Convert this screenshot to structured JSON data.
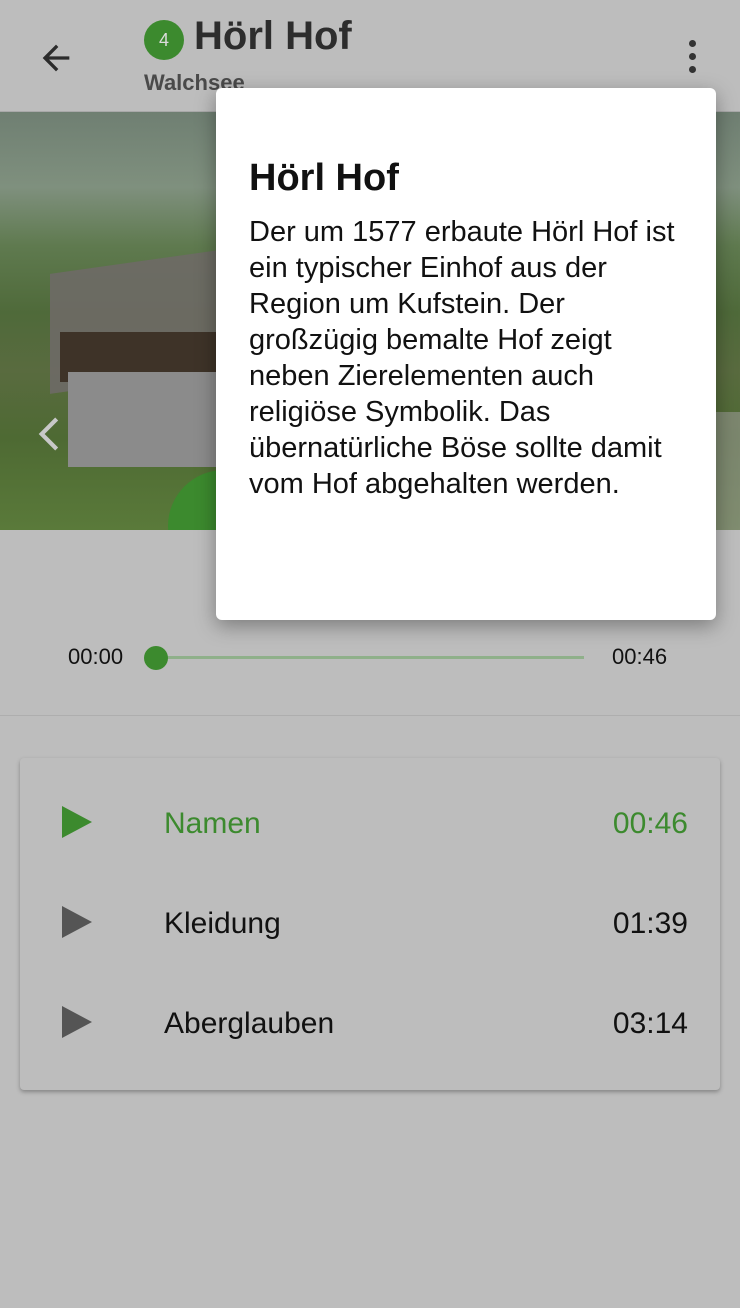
{
  "header": {
    "stop_number": "4",
    "title": "Hörl Hof",
    "subtitle": "Walchsee"
  },
  "player": {
    "current_time": "00:00",
    "duration": "00:46",
    "progress": 0
  },
  "tracks": [
    {
      "label": "Namen",
      "duration": "00:46",
      "active": true
    },
    {
      "label": "Kleidung",
      "duration": "01:39",
      "active": false
    },
    {
      "label": "Aberglauben",
      "duration": "03:14",
      "active": false
    }
  ],
  "dialog": {
    "title": "Hörl Hof",
    "body": "Der um 1577 erbaute Hörl Hof ist ein typischer Einhof aus der Region um Kufstein. Der großzügig bemalte Hof zeigt neben Zierelementen auch religiöse Symbolik. Das übernatürliche Böse sollte damit vom Hof abgehalten werden."
  },
  "colors": {
    "accent": "#3c8a2e",
    "scrim_background": "#bdbdbd",
    "dialog_background": "#ffffff"
  },
  "icons": [
    "back-arrow-icon",
    "more-vert-icon",
    "chevron-left-icon",
    "play-icon"
  ]
}
